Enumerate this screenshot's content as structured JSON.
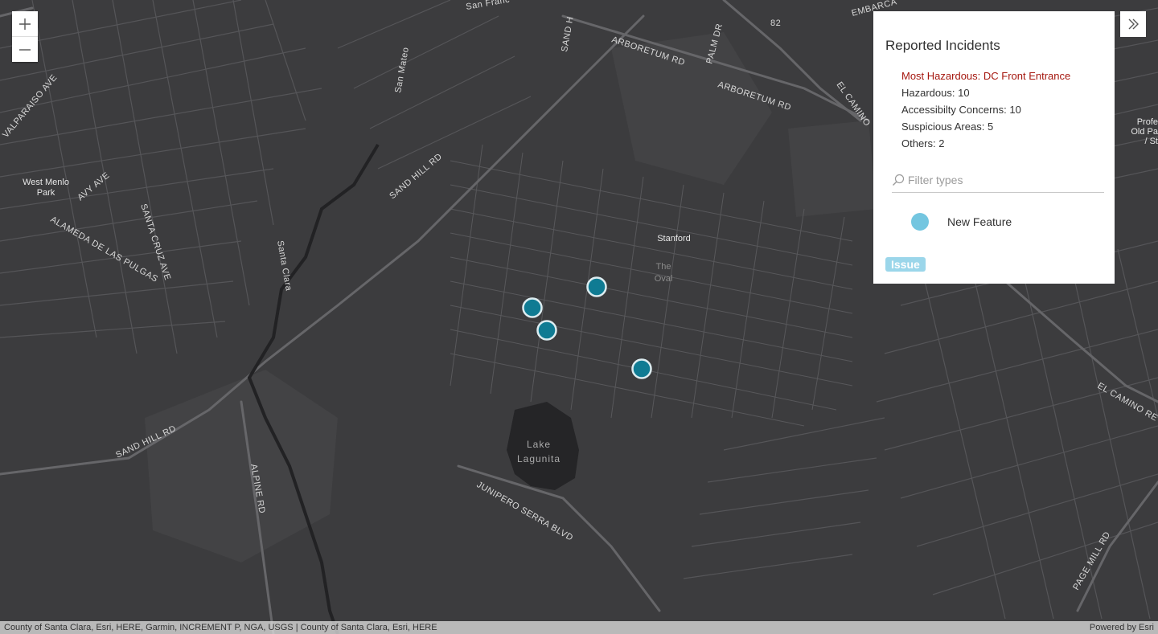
{
  "map": {
    "labels": {
      "sand_hill_rd_1": "SAND HILL RD",
      "sand_hill_rd_2": "SAND HILL RD",
      "arboretum_rd_1": "ARBORETUM RD",
      "arboretum_rd_2": "ARBORETUM RD",
      "palm_dr": "PALM DR",
      "el_camino_1": "EL CAMINO",
      "el_camino_2": "EL CAMINO RE",
      "valparaiso": "VALPARAISO AVE",
      "avy": "AVY AVE",
      "alameda": "ALAMEDA DE LAS PULGAS",
      "santa_cruz": "SANTA CRUZ AVE",
      "alpine": "ALPINE RD",
      "junipero": "JUNIPERO SERRA BLVD",
      "page_mill": "PAGE MILL RD",
      "san_mateo": "San Mateo",
      "santa_clara": "Santa Clara",
      "san_francisco": "San Franc",
      "embarcadero": "EMBARCA",
      "sand_hill_top": "SAND H",
      "route_82": "82"
    },
    "places": {
      "west_menlo": [
        "West Menlo",
        "Park"
      ],
      "stanford": "Stanford",
      "oval": [
        "The",
        "Oval"
      ],
      "lake": [
        "Lake",
        "Lagunita"
      ],
      "old_palo": [
        "Profe",
        "Old Pa",
        "/ St"
      ]
    },
    "markers": [
      {
        "name": "incident-marker",
        "lat": 37.4282,
        "lon": -122.1713
      },
      {
        "name": "incident-marker",
        "lat": 37.4272,
        "lon": -122.1745
      },
      {
        "name": "incident-marker",
        "lat": 37.4262,
        "lon": -122.1737
      },
      {
        "name": "incident-marker",
        "lat": 37.4246,
        "lon": -122.1687
      }
    ],
    "marker_color": "#0f7b93"
  },
  "zoom": {
    "in_icon": "plus-icon",
    "out_icon": "minus-icon"
  },
  "panel": {
    "title": "Reported Incidents",
    "stats": [
      {
        "text": "Most Hazardous: DC Front Entrance",
        "danger": true
      },
      {
        "text": "Hazardous: 10",
        "danger": false
      },
      {
        "text": "Accessibilty Concerns: 10",
        "danger": false
      },
      {
        "text": "Suspicious Areas: 5",
        "danger": false
      },
      {
        "text": "Others: 2",
        "danger": false
      }
    ],
    "filter_placeholder": "Filter types",
    "feature_label": "New Feature",
    "feature_color": "#74c6e0",
    "issue_label": "Issue",
    "danger_color": "#a5170f"
  },
  "attribution": {
    "left": "County of Santa Clara, Esri, HERE, Garmin, INCREMENT P, NGA, USGS | County of Santa Clara, Esri, HERE",
    "right": "Powered by Esri"
  }
}
